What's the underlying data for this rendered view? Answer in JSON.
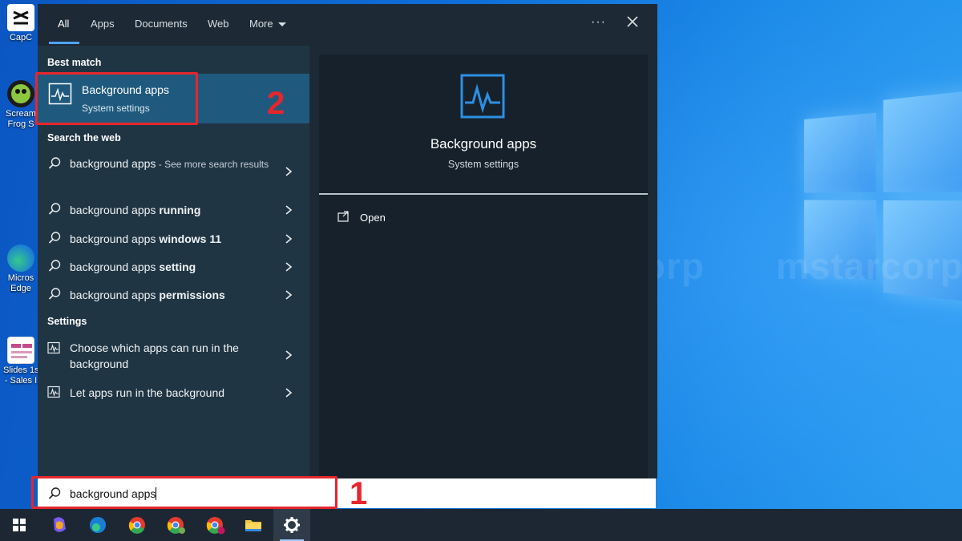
{
  "desktop": {
    "icons": [
      {
        "label": "CapC"
      },
      {
        "label": "Scream\nFrog S"
      },
      {
        "label": "Micros\nEdge"
      },
      {
        "label": "Slides 1s\n- Sales I"
      }
    ],
    "watermark": "mstarcorp"
  },
  "search_panel": {
    "tabs": [
      {
        "label": "All",
        "active": true
      },
      {
        "label": "Apps"
      },
      {
        "label": "Documents"
      },
      {
        "label": "Web"
      },
      {
        "label": "More"
      }
    ],
    "more_options_label": "···",
    "best_match": {
      "heading": "Best match",
      "title": "Background apps",
      "subtitle": "System settings",
      "icon": "activity-chart-icon"
    },
    "web": {
      "heading": "Search web",
      "items": [
        {
          "prefix": "background apps",
          "bold": "",
          "suffix": " - See more search results"
        },
        {
          "prefix": "background apps ",
          "bold": "running",
          "suffix": ""
        },
        {
          "prefix": "background apps ",
          "bold": "windows 11",
          "suffix": ""
        },
        {
          "prefix": "background apps ",
          "bold": "setting",
          "suffix": ""
        },
        {
          "prefix": "background apps ",
          "bold": "permissions",
          "suffix": ""
        }
      ]
    },
    "web_heading_full": "Search the web",
    "settings": {
      "heading": "Settings",
      "items": [
        {
          "label": "Choose which apps can run in the background"
        },
        {
          "label": "Let apps run in the background"
        }
      ]
    },
    "preview": {
      "title": "Background apps",
      "subtitle": "System settings",
      "action_open": "Open"
    }
  },
  "search_box": {
    "value": "background apps"
  },
  "annotations": {
    "step1": "1",
    "step2": "2",
    "color": "#e6262d"
  },
  "taskbar": {
    "items": [
      "start-icon",
      "copilot-icon",
      "edge-icon",
      "chrome-icon",
      "chrome-profile-icon",
      "chrome-profile-n-icon",
      "file-explorer-icon",
      "settings-icon"
    ]
  },
  "colors": {
    "panel_bg": "#1d2a35",
    "selected_bg": "#1f5a7e",
    "accent": "#4ea4ff"
  }
}
